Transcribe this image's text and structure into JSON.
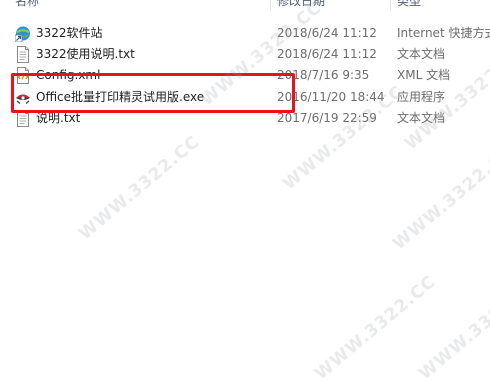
{
  "columns": {
    "name": "名称",
    "date": "修改日期",
    "type": "类型"
  },
  "files": [
    {
      "name": "3322软件站",
      "date": "2018/6/24 11:12",
      "type": "Internet 快捷方式",
      "icon": "internet-shortcut-icon"
    },
    {
      "name": "3322使用说明.txt",
      "date": "2018/6/24 11:12",
      "type": "文本文档",
      "icon": "text-document-icon"
    },
    {
      "name": "Config.xml",
      "date": "2018/7/16 9:35",
      "type": "XML 文档",
      "icon": "xml-document-icon"
    },
    {
      "name": "Office批量打印精灵试用版.exe",
      "date": "2016/11/20 18:44",
      "type": "应用程序",
      "icon": "application-exe-icon"
    },
    {
      "name": "说明.txt",
      "date": "2017/6/19 22:59",
      "type": "文本文档",
      "icon": "text-document-icon"
    }
  ],
  "watermark_text": "WWW.3322.CC",
  "highlight": {
    "target_file": "Office批量打印精灵试用版.exe",
    "color": "#e8131b"
  }
}
